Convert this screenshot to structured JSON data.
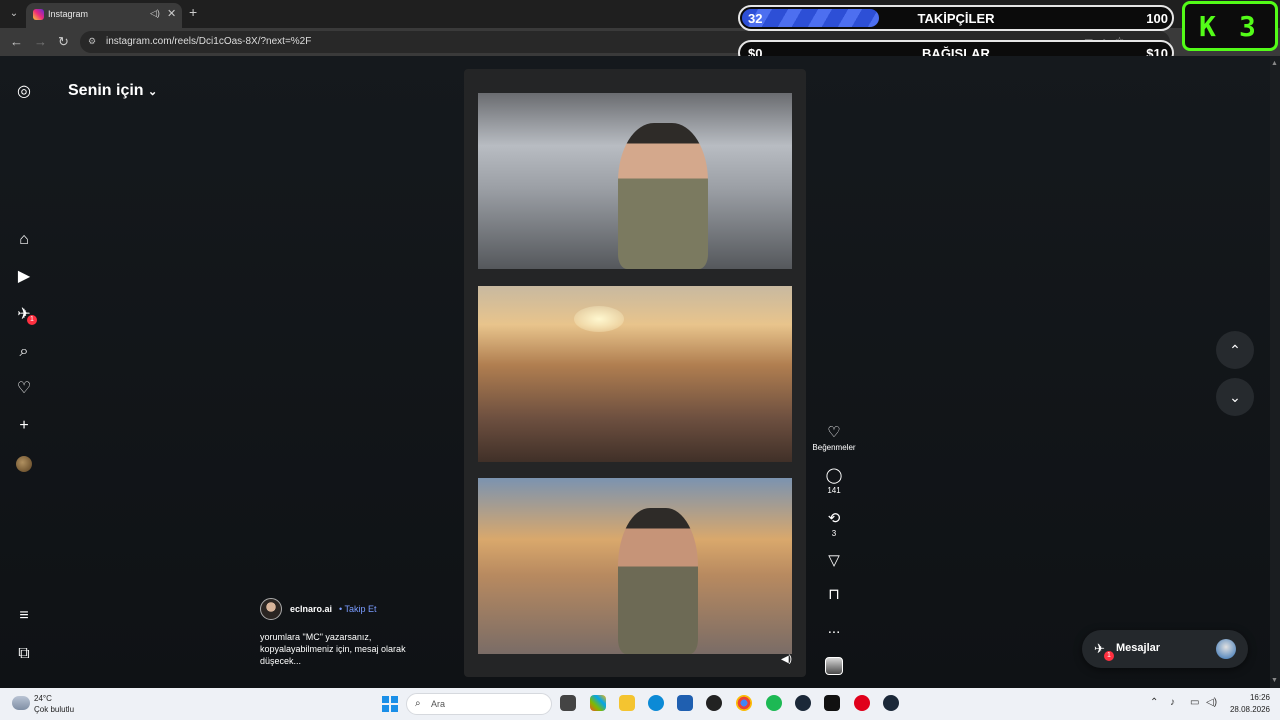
{
  "browser": {
    "tab_title": "Instagram",
    "url": "instagram.com/reels/Dci1cOas-8X/?next=%2F"
  },
  "overlay": {
    "followers": {
      "current": "32",
      "label": "TAKİPÇİLER",
      "goal": "100",
      "progress_fraction": 0.32
    },
    "donations": {
      "current": "$0",
      "label": "BAĞIŞLAR",
      "goal": "$10"
    },
    "kick": {
      "logo": "K",
      "number": "3"
    }
  },
  "sidebar": {
    "feed_title": "Senin için",
    "notifications_badge": "1"
  },
  "reel": {
    "author": "eclnaro.ai",
    "follow_label": "• Takip Et",
    "caption": "yorumlara \"MC\" yazarsanız, kopyalayabilmeniz için, mesaj olarak düşecek..."
  },
  "actions": {
    "likes_label": "Beğenmeler",
    "comments_count": "141",
    "reposts_count": "3",
    "more": "..."
  },
  "messages": {
    "label": "Mesajlar",
    "badge": "1"
  },
  "taskbar": {
    "temperature": "24°C",
    "weather": "Çok bulutlu",
    "search_placeholder": "Ara",
    "time": "16:26",
    "date": "28.08.2026"
  },
  "colors": {
    "accent_follow": "#7a9cff",
    "kick_green": "#53fc18",
    "badge_red": "#ff3040"
  }
}
